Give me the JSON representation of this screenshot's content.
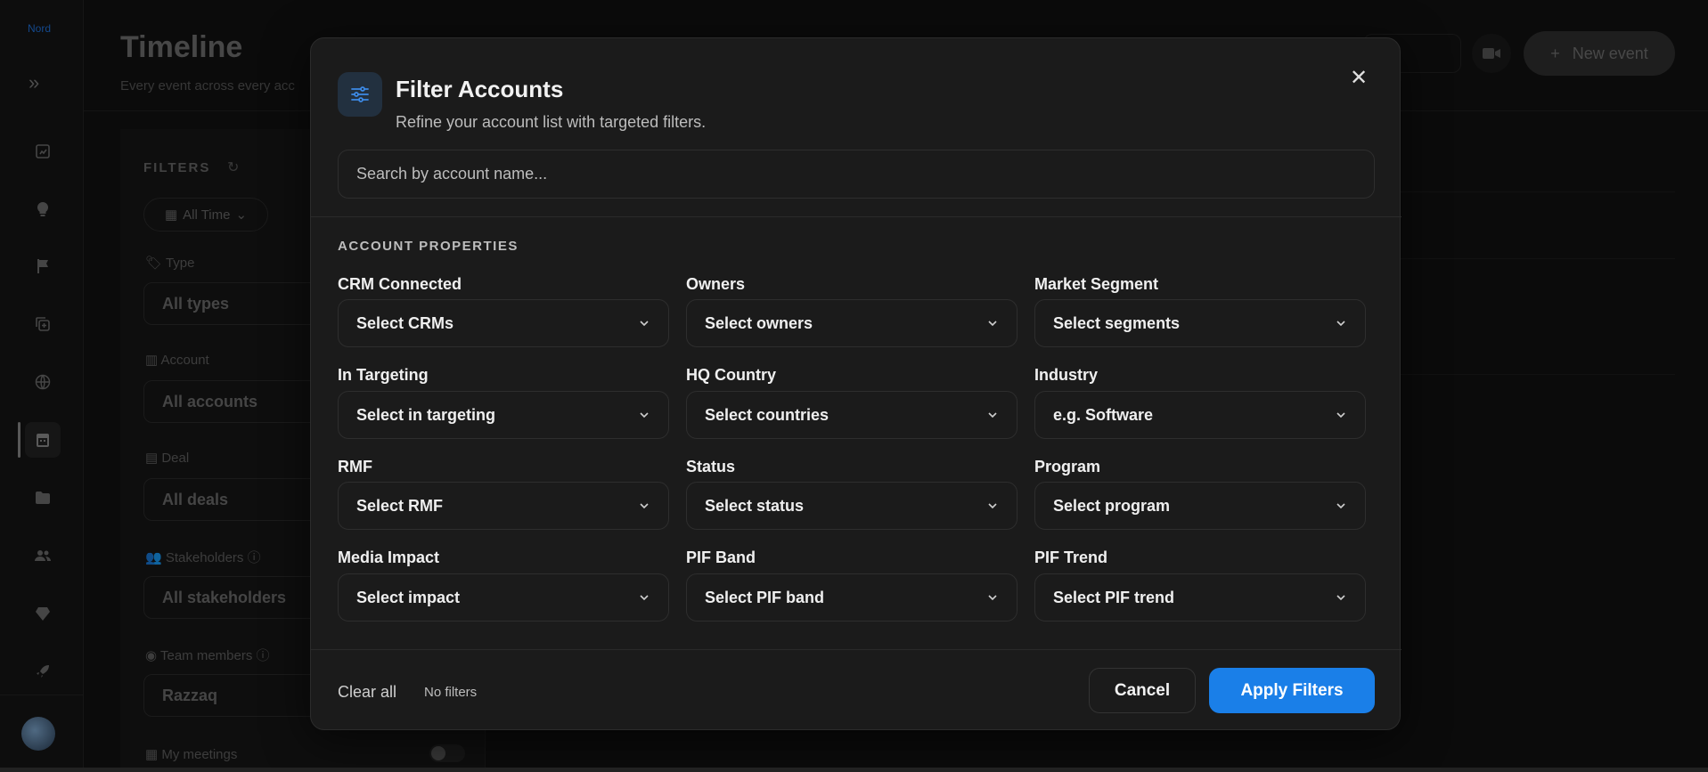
{
  "app": {
    "logo_text": "Nord",
    "page_title": "Timeline",
    "page_subtitle": "Every event across every acc",
    "new_event_label": "New event"
  },
  "rail": {
    "icons": [
      "expand-icon",
      "reports-icon",
      "insights-icon",
      "flag-icon",
      "copy-icon",
      "globe-icon",
      "calendar-icon",
      "folder-icon",
      "people-icon",
      "diamond-icon",
      "rocket-icon"
    ]
  },
  "filters_panel": {
    "title": "FILTERS",
    "time_chip": "All Time",
    "type_label": "Type",
    "type_value": "All types",
    "account_label": "Account",
    "account_value": "All accounts",
    "deal_label": "Deal",
    "deal_value": "All deals",
    "stakeholders_label": "Stakeholders",
    "stakeholders_value": "All stakeholders",
    "team_label": "Team members",
    "team_value": "Razzaq",
    "meetings_label": "My meetings"
  },
  "modal": {
    "title": "Filter Accounts",
    "subtitle": "Refine your account list with targeted filters.",
    "search_placeholder": "Search by account name...",
    "section_title": "ACCOUNT PROPERTIES",
    "fields": [
      {
        "label": "CRM Connected",
        "value": "Select CRMs"
      },
      {
        "label": "Owners",
        "value": "Select owners"
      },
      {
        "label": "Market Segment",
        "value": "Select segments"
      },
      {
        "label": "In Targeting",
        "value": "Select in targeting"
      },
      {
        "label": "HQ Country",
        "value": "Select countries"
      },
      {
        "label": "Industry",
        "value": "e.g. Software"
      },
      {
        "label": "RMF",
        "value": "Select RMF"
      },
      {
        "label": "Status",
        "value": "Select status"
      },
      {
        "label": "Program",
        "value": "Select program"
      },
      {
        "label": "Media Impact",
        "value": "Select impact"
      },
      {
        "label": "PIF Band",
        "value": "Select PIF band"
      },
      {
        "label": "PIF Trend",
        "value": "Select PIF trend"
      }
    ],
    "clear_all_label": "Clear all",
    "filter_count_text": "No filters",
    "cancel_label": "Cancel",
    "apply_label": "Apply Filters"
  },
  "colors": {
    "accent": "#1a7fe8",
    "modal_bg": "#1b1b1b",
    "icon_tile_bg": "#22303f"
  }
}
